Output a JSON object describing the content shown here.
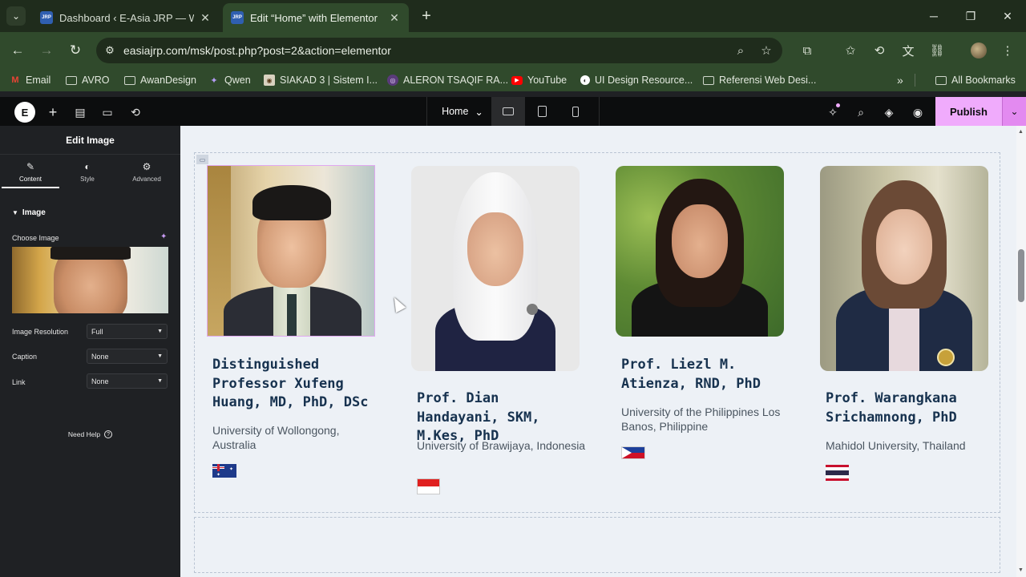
{
  "browser": {
    "tabs": [
      {
        "favicon_text": "E-Asia JRP",
        "title": "Dashboard ‹ E-Asia JRP — Wor",
        "active": false
      },
      {
        "favicon_text": "E-Asia JRP",
        "title": "Edit “Home” with Elementor",
        "active": true
      }
    ],
    "new_tab_label": "+",
    "url": "easiajrp.com/msk/post.php?post=2&action=elementor",
    "bookmarks": [
      {
        "icon": "gmail-icon",
        "label": "Email"
      },
      {
        "icon": "folder-icon",
        "label": "AVRO"
      },
      {
        "icon": "folder-icon",
        "label": "AwanDesign"
      },
      {
        "icon": "qwen-icon",
        "label": "Qwen"
      },
      {
        "icon": "siakad-icon",
        "label": "SIAKAD 3 | Sistem I..."
      },
      {
        "icon": "aleron-icon",
        "label": "ALERON TSAQIF RA..."
      },
      {
        "icon": "youtube-icon",
        "label": "YouTube"
      },
      {
        "icon": "globe-icon",
        "label": "UI Design Resource..."
      },
      {
        "icon": "folder-icon",
        "label": "Referensi Web Desi..."
      }
    ],
    "all_bookmarks_label": "All Bookmarks"
  },
  "elementor": {
    "page_selector": "Home",
    "publish_label": "Publish",
    "panel": {
      "title": "Edit Image",
      "tabs": [
        {
          "icon": "pencil-icon",
          "label": "Content"
        },
        {
          "icon": "half-circle-icon",
          "label": "Style"
        },
        {
          "icon": "gear-icon",
          "label": "Advanced"
        }
      ],
      "section_title": "Image",
      "choose_image_label": "Choose Image",
      "fields": [
        {
          "label": "Image Resolution",
          "value": "Full"
        },
        {
          "label": "Caption",
          "value": "None"
        },
        {
          "label": "Link",
          "value": "None"
        }
      ],
      "need_help": "Need Help"
    }
  },
  "people": [
    {
      "name": "Distinguished Professor Xufeng Huang, MD, PhD, DSc",
      "university": "University of Wollongong, Australia",
      "flag": "australia"
    },
    {
      "name": "Prof. Dian Handayani, SKM, M.Kes, PhD",
      "university": "University of Brawijaya, Indonesia",
      "flag": "indonesia"
    },
    {
      "name": "Prof. Liezl M. Atienza, RND, PhD",
      "university": "University of the Philippines Los Banos, Philippine",
      "flag": "philippines"
    },
    {
      "name": "Prof. Warangkana Srichamnong, PhD",
      "university": "Mahidol University, Thailand",
      "flag": "thailand"
    }
  ],
  "colors": {
    "chrome_tabstrip": "#1f2c1c",
    "chrome_toolbar": "#304a2c",
    "elementor_bar": "#0c0d0e",
    "publish_accent": "#f0abfc",
    "panel_bg": "#1f2124",
    "canvas_bg": "#edf1f6",
    "name_text": "#17324f"
  }
}
